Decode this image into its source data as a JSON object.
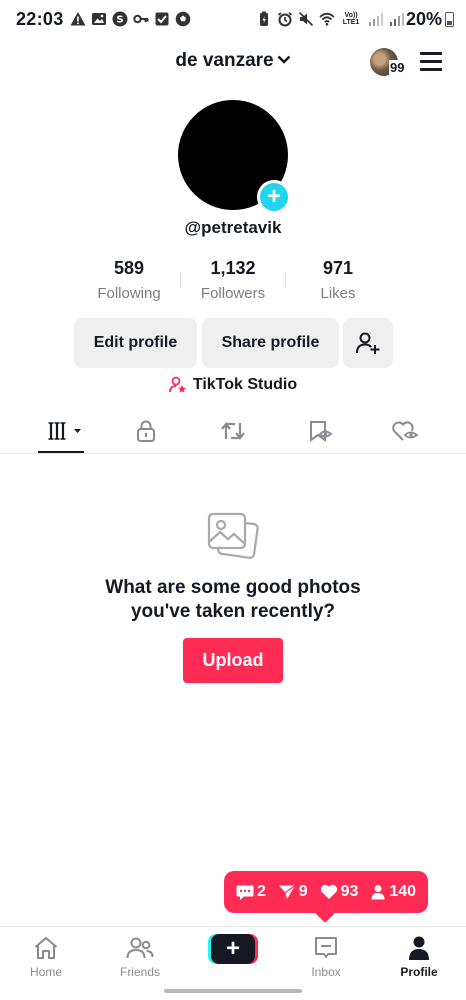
{
  "status_bar": {
    "time": "22:03",
    "left_icons": [
      "warning-icon",
      "image-icon",
      "shazam-icon",
      "key-icon",
      "checkbox-icon",
      "soccer-ball-icon"
    ],
    "right_icons": [
      "battery-saver-icon",
      "alarm-icon",
      "mute-icon",
      "wifi-icon",
      "signal-icon",
      "signal-icon"
    ],
    "volte_label": "Vo)) LTE1",
    "battery": "20%"
  },
  "header": {
    "title": "de vanzare",
    "notification_count": "99"
  },
  "profile": {
    "username": "@petretavik",
    "stats": [
      {
        "value": "589",
        "label": "Following"
      },
      {
        "value": "1,132",
        "label": "Followers"
      },
      {
        "value": "971",
        "label": "Likes"
      }
    ],
    "edit_profile_label": "Edit profile",
    "share_profile_label": "Share profile",
    "studio_label": "TikTok Studio"
  },
  "tabs": [
    "videos-tab",
    "private-tab",
    "reposts-tab",
    "favorites-tab",
    "liked-tab"
  ],
  "empty_state": {
    "line1": "What are some good photos",
    "line2": "you've taken recently?",
    "upload_label": "Upload"
  },
  "activity_bubble": {
    "comments": "2",
    "shares": "9",
    "likes": "93",
    "followers": "140"
  },
  "bottom_nav": [
    {
      "label": "Home",
      "icon": "home-icon"
    },
    {
      "label": "Friends",
      "icon": "friends-icon"
    },
    {
      "label": "",
      "icon": "plus-icon"
    },
    {
      "label": "Inbox",
      "icon": "inbox-icon"
    },
    {
      "label": "Profile",
      "icon": "profile-icon"
    }
  ],
  "colors": {
    "accent": "#fe2c55",
    "cyan": "#20d5ec",
    "text": "#161823",
    "muted": "#7c7d83"
  }
}
